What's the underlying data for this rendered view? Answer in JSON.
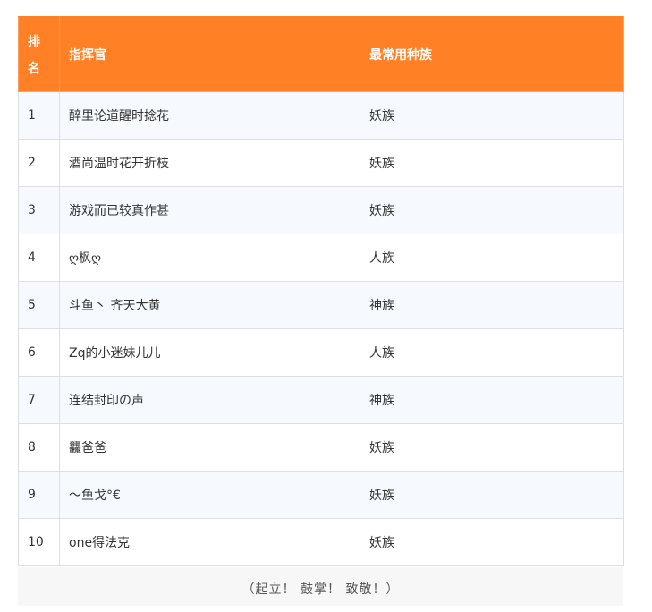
{
  "table": {
    "headers": {
      "rank": "排名",
      "commander": "指挥官",
      "race": "最常用种族"
    },
    "rows": [
      {
        "rank": "1",
        "commander": "醉里论道醒时捻花",
        "race": "妖族"
      },
      {
        "rank": "2",
        "commander": "酒尚温时花开折枝",
        "race": "妖族"
      },
      {
        "rank": "3",
        "commander": "游戏而已较真作甚",
        "race": "妖族"
      },
      {
        "rank": "4",
        "commander": "ღ枫ღ",
        "race": "人族"
      },
      {
        "rank": "5",
        "commander": "斗鱼丶 齐天大黄",
        "race": "神族"
      },
      {
        "rank": "6",
        "commander": "Zq的小迷妹儿儿",
        "race": "人族"
      },
      {
        "rank": "7",
        "commander": "连结封印の声",
        "race": "神族"
      },
      {
        "rank": "8",
        "commander": "龘爸爸",
        "race": "妖族"
      },
      {
        "rank": "9",
        "commander": "～鱼戈°€",
        "race": "妖族"
      },
      {
        "rank": "10",
        "commander": "one得法克",
        "race": "妖族"
      }
    ]
  },
  "caption": "（起立！ 鼓掌！ 致敬！）",
  "colors": {
    "header_bg": "#ff8025",
    "header_text": "#ffffff",
    "row_alt_bg": "#f6f9fd",
    "border": "#dcdfe3"
  }
}
